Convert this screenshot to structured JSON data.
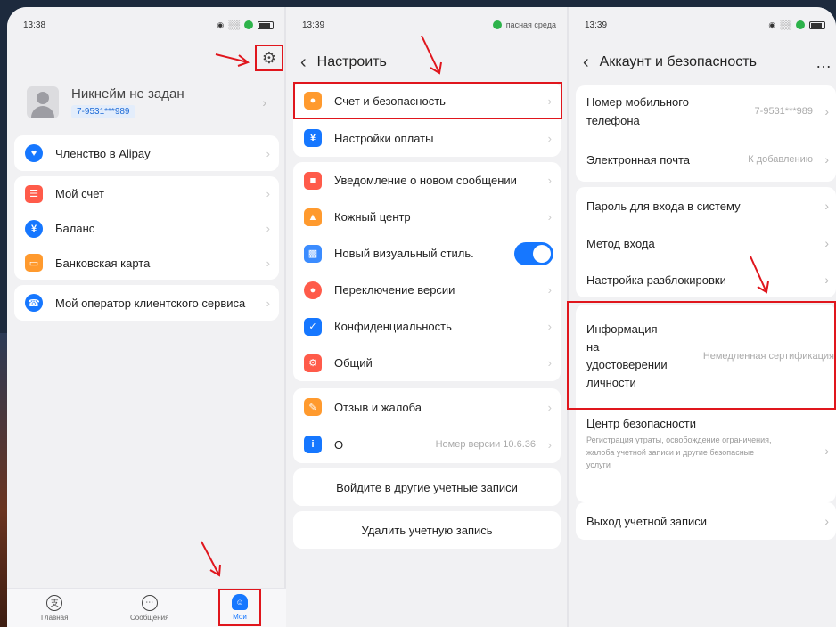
{
  "colors": {
    "accent": "#1677ff",
    "highlight": "#e0161d",
    "card": "#ffffff",
    "page": "#f1f1f3"
  },
  "panel1": {
    "status": {
      "time": "13:38",
      "icons": "● ○ ᴷᴴ 📡"
    },
    "profile": {
      "nickname": "Никнейм не задан",
      "phone": "7-9531***989"
    },
    "items": [
      {
        "label": "Членство в Alipay",
        "icon": "membership-icon",
        "color": "#1677ff"
      },
      {
        "label": "Мой счет",
        "icon": "account-icon",
        "color": "#ff5b4a"
      },
      {
        "label": "Баланс",
        "icon": "balance-icon",
        "color": "#1677ff"
      },
      {
        "label": "Банковская карта",
        "icon": "bank-card-icon",
        "color": "#ff9a2e"
      },
      {
        "label": "Мой оператор клиентского сервиса",
        "icon": "headset-icon",
        "color": "#1677ff"
      }
    ],
    "tabs": [
      {
        "label": "Главная",
        "glyph": "支"
      },
      {
        "label": "Сообщения",
        "glyph": "⋯"
      },
      {
        "label": "Мои",
        "glyph": "☺"
      }
    ]
  },
  "panel2": {
    "status": {
      "time": "13:39",
      "network": "пасная среда"
    },
    "title": "Настроить",
    "items": [
      {
        "label": "Счет и безопасность",
        "color": "#ff9a2e"
      },
      {
        "label": "Настройки оплаты",
        "color": "#1677ff"
      },
      {
        "label": "Уведомление о новом сообщении",
        "color": "#ff5b4a"
      },
      {
        "label": "Кожный центр",
        "color": "#ff9a2e"
      },
      {
        "label": "Новый визуальный стиль.",
        "color": "#3b8cff",
        "toggle": true
      },
      {
        "label": "Переключение версии",
        "color": "#ff5b4a"
      },
      {
        "label": "Конфиденциальность",
        "color": "#1677ff"
      },
      {
        "label": "Общий",
        "color": "#ff5b4a"
      },
      {
        "label": "Отзыв и жалоба",
        "color": "#ff9a2e"
      },
      {
        "label": "О",
        "color": "#1677ff",
        "value": "Номер версии 10.6.36"
      }
    ],
    "buttons": {
      "switch_account": "Войдите в другие учетные записи",
      "delete_account": "Удалить учетную запись"
    }
  },
  "panel3": {
    "status": {
      "time": "13:39"
    },
    "title": "Аккаунт и безопасность",
    "more": "…",
    "items": [
      {
        "label_line1": "Номер мобильного",
        "label_line2": "телефона",
        "value": "7-9531***989"
      },
      {
        "label": "Электронная почта",
        "value": "К добавлению"
      },
      {
        "label": "Пароль для входа в систему"
      },
      {
        "label": "Метод входа"
      },
      {
        "label": "Настройка разблокировки"
      },
      {
        "label_lines": [
          "Информация",
          "на",
          "удостоверении",
          "личности"
        ],
        "value": "Немедленная сертификация"
      },
      {
        "label": "Центр безопасности",
        "sub_lines": [
          "Регистрация утраты, освобождение ограничения,",
          "жалоба учетной записи и другие безопасные",
          "услуги"
        ]
      },
      {
        "label": "Выход учетной записи"
      }
    ]
  }
}
